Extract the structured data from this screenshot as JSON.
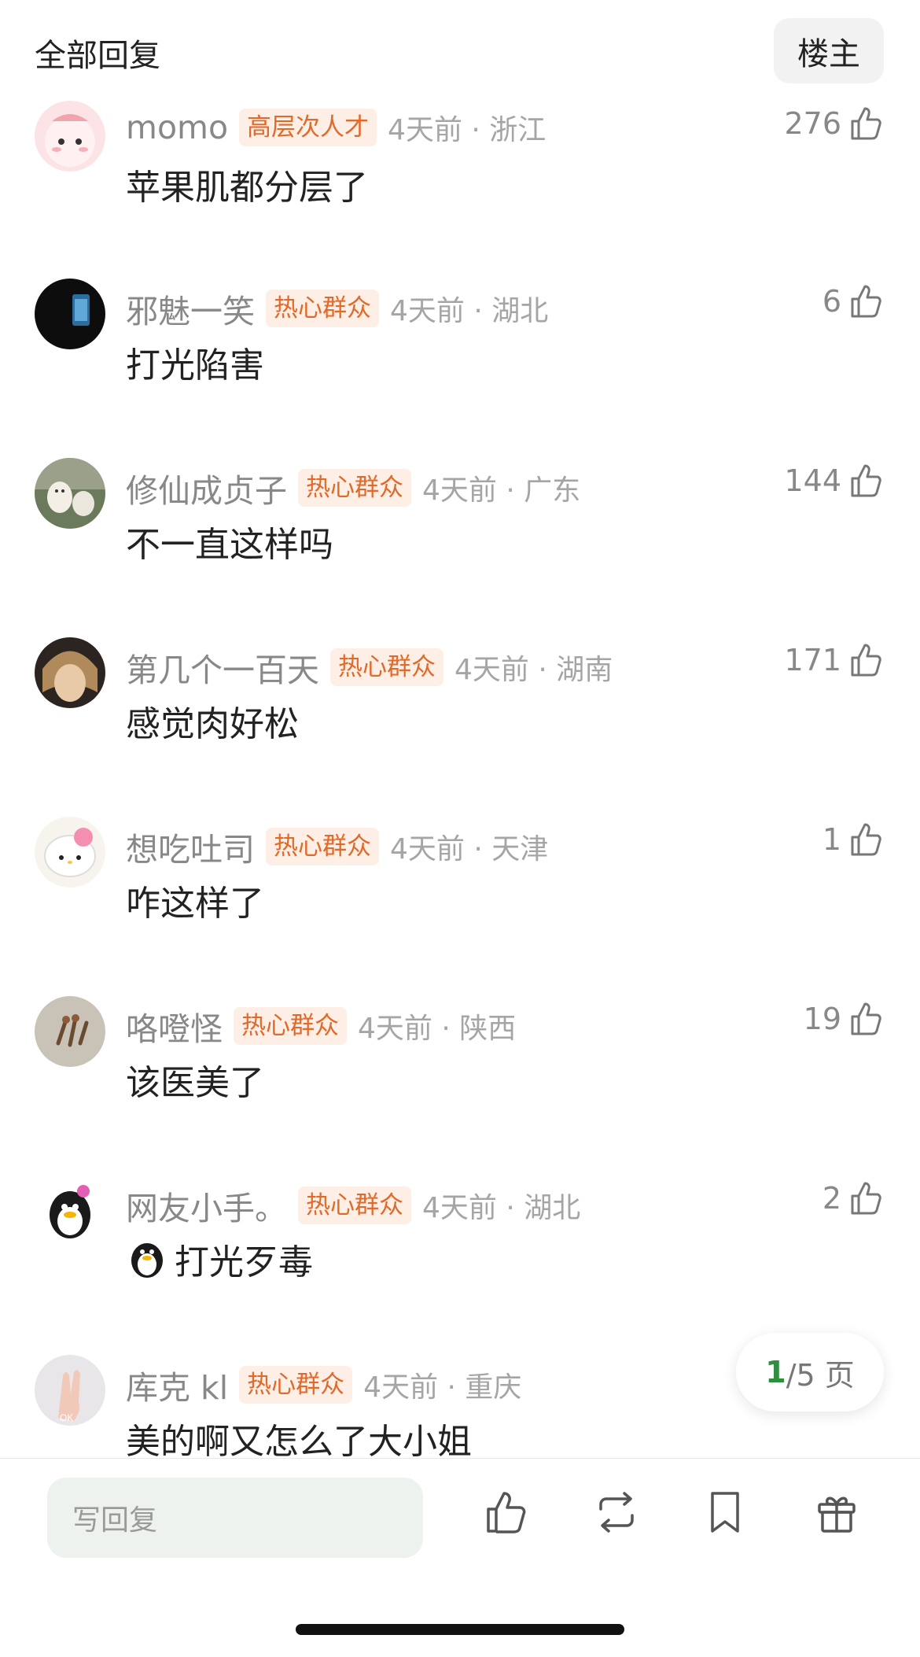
{
  "header": {
    "title": "全部回复",
    "owner_button": "楼主"
  },
  "comments": [
    {
      "username": "momo",
      "badge": "高层次人才",
      "time_location": "4天前 · 浙江",
      "text": "苹果肌都分层了",
      "likes": "276",
      "avatar_icon": "pink-cartoon-avatar"
    },
    {
      "username": "邪魅一笑",
      "badge": "热心群众",
      "time_location": "4天前 · 湖北",
      "text": "打光陷害",
      "likes": "6",
      "avatar_icon": "dark-phone-avatar"
    },
    {
      "username": "修仙成贞子",
      "badge": "热心群众",
      "time_location": "4天前 · 广东",
      "text": "不一直这样吗",
      "likes": "144",
      "avatar_icon": "lambs-avatar"
    },
    {
      "username": "第几个一百天",
      "badge": "热心群众",
      "time_location": "4天前 · 湖南",
      "text": "感觉肉好松",
      "likes": "171",
      "avatar_icon": "person-avatar"
    },
    {
      "username": "想吃吐司",
      "badge": "热心群众",
      "time_location": "4天前 · 天津",
      "text": "咋这样了",
      "likes": "1",
      "avatar_icon": "hello-kitty-avatar"
    },
    {
      "username": "咯噔怪",
      "badge": "热心群众",
      "time_location": "4天前 · 陕西",
      "text": "该医美了",
      "likes": "19",
      "avatar_icon": "dried-flower-avatar"
    },
    {
      "username": "网友小手。",
      "badge": "热心群众",
      "time_location": "4天前 · 湖北",
      "text": "打光歹毒",
      "likes": "2",
      "avatar_icon": "penguin-avatar",
      "emoji": "penguin-emoji"
    },
    {
      "username": "库克 kl",
      "badge": "热心群众",
      "time_location": "4天前 · 重庆",
      "text": "美的啊又怎么了大小姐",
      "likes": "",
      "avatar_icon": "ok-hand-avatar"
    }
  ],
  "pagination": {
    "current": "1",
    "total": "/5 页"
  },
  "bottom_bar": {
    "reply_placeholder": "写回复"
  },
  "colors": {
    "badge_text": "#e06a2a",
    "badge_bg": "#fdeee6",
    "page_current": "#2f8f3f"
  }
}
